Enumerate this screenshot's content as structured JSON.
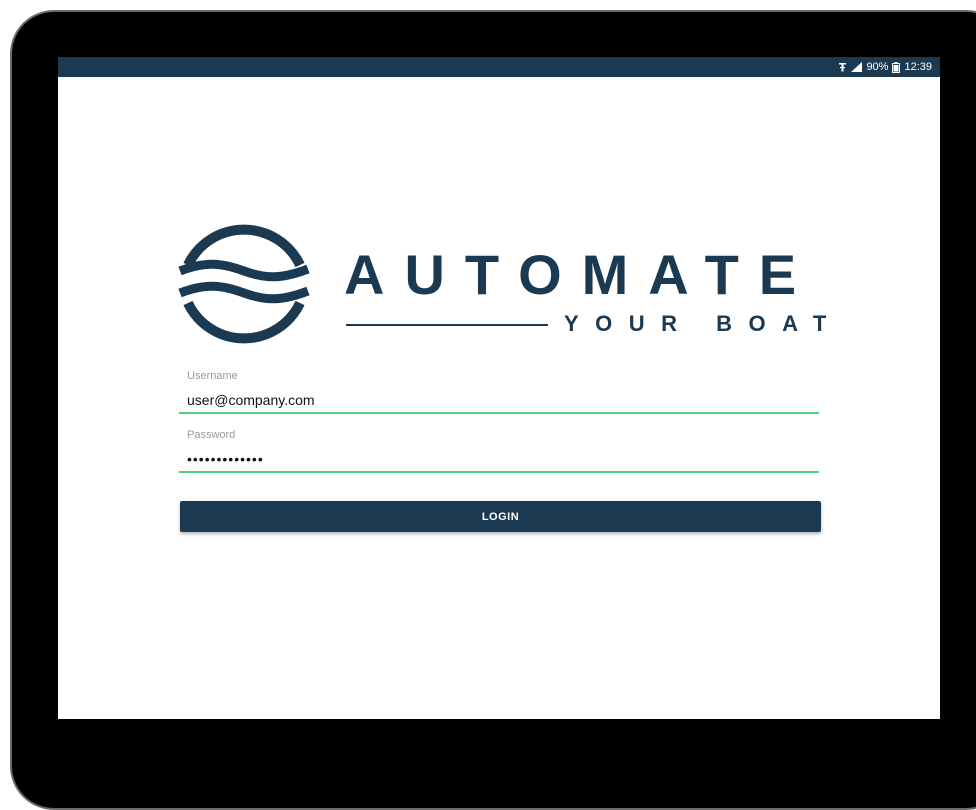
{
  "status_bar": {
    "battery": "90%",
    "time": "12:39",
    "icons": [
      "sim-icon",
      "signal-icon",
      "battery-icon"
    ]
  },
  "logo": {
    "wordmark": "AUTOMATE",
    "tagline": "YOUR BOAT"
  },
  "login_form": {
    "username_label": "Username",
    "username_value": "user@company.com",
    "password_label": "Password",
    "password_value": "•••••••••••••",
    "login_label": "LOGIN"
  },
  "colors": {
    "brand": "#1b3a52",
    "input_underline": "#4cd17f"
  }
}
